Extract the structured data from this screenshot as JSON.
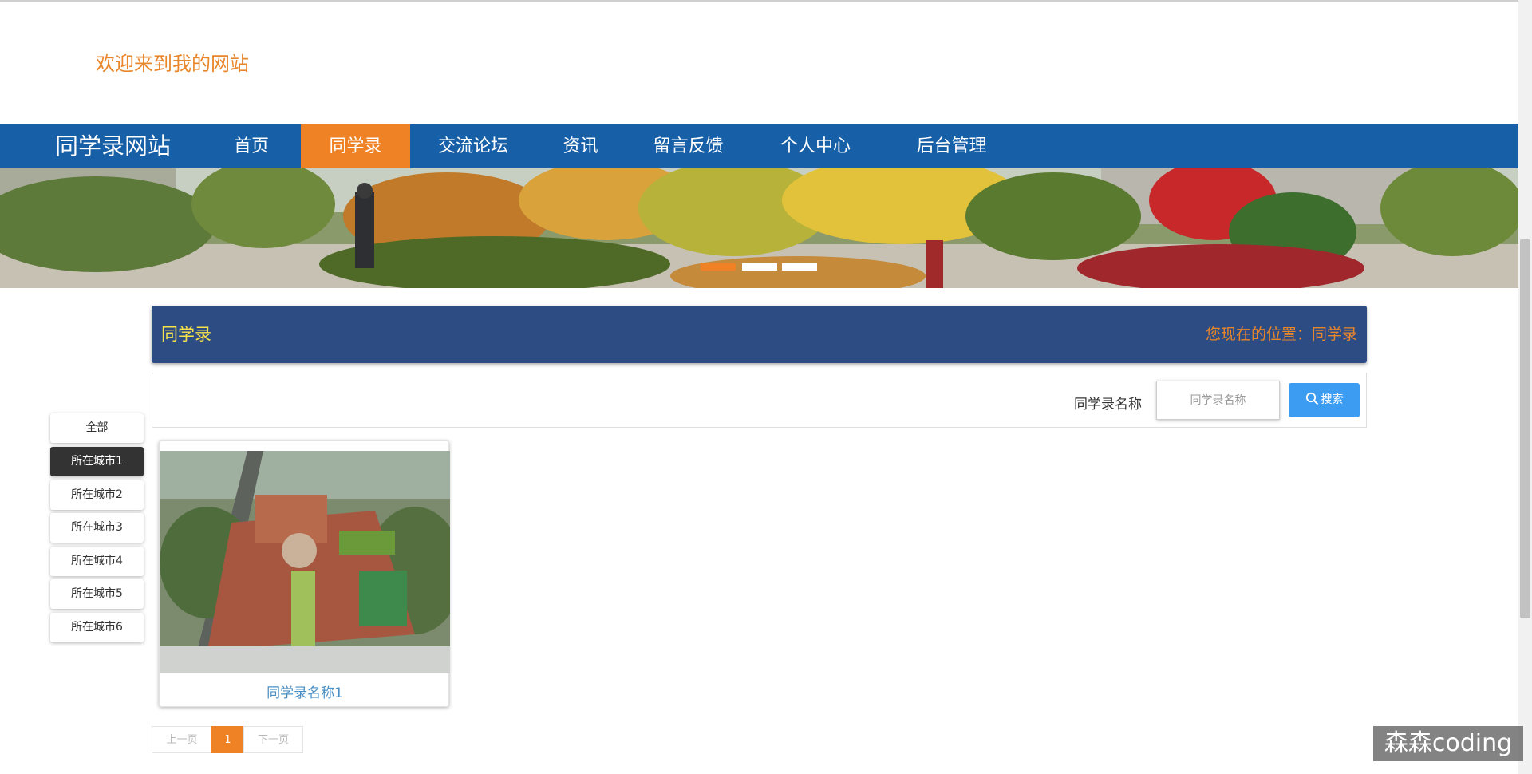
{
  "header": {
    "welcome_text": "欢迎来到我的网站"
  },
  "nav": {
    "brand": "同学录网站",
    "items": [
      {
        "label": "首页",
        "active": false
      },
      {
        "label": "同学录",
        "active": true
      },
      {
        "label": "交流论坛",
        "active": false
      },
      {
        "label": "资讯",
        "active": false
      },
      {
        "label": "留言反馈",
        "active": false
      },
      {
        "label": "个人中心",
        "active": false
      },
      {
        "label": "后台管理",
        "active": false
      }
    ]
  },
  "banner": {
    "slides": 3,
    "active_slide": 1
  },
  "section": {
    "title": "同学录",
    "breadcrumb": "您现在的位置：同学录"
  },
  "search": {
    "label": "同学录名称",
    "placeholder": "同学录名称",
    "value": "",
    "button_label": "搜索"
  },
  "filters": [
    {
      "label": "全部",
      "active": false
    },
    {
      "label": "所在城市1",
      "active": true
    },
    {
      "label": "所在城市2",
      "active": false
    },
    {
      "label": "所在城市3",
      "active": false
    },
    {
      "label": "所在城市4",
      "active": false
    },
    {
      "label": "所在城市5",
      "active": false
    },
    {
      "label": "所在城市6",
      "active": false
    }
  ],
  "cards": [
    {
      "title": "同学录名称1"
    }
  ],
  "pagination": {
    "prev_label": "上一页",
    "current_page": "1",
    "next_label": "下一页"
  },
  "watermark": "森森coding",
  "colors": {
    "nav_bg": "#1760a8",
    "accent": "#ef8224",
    "section_bg": "#2d4c84",
    "search_button": "#3c9cf2"
  }
}
